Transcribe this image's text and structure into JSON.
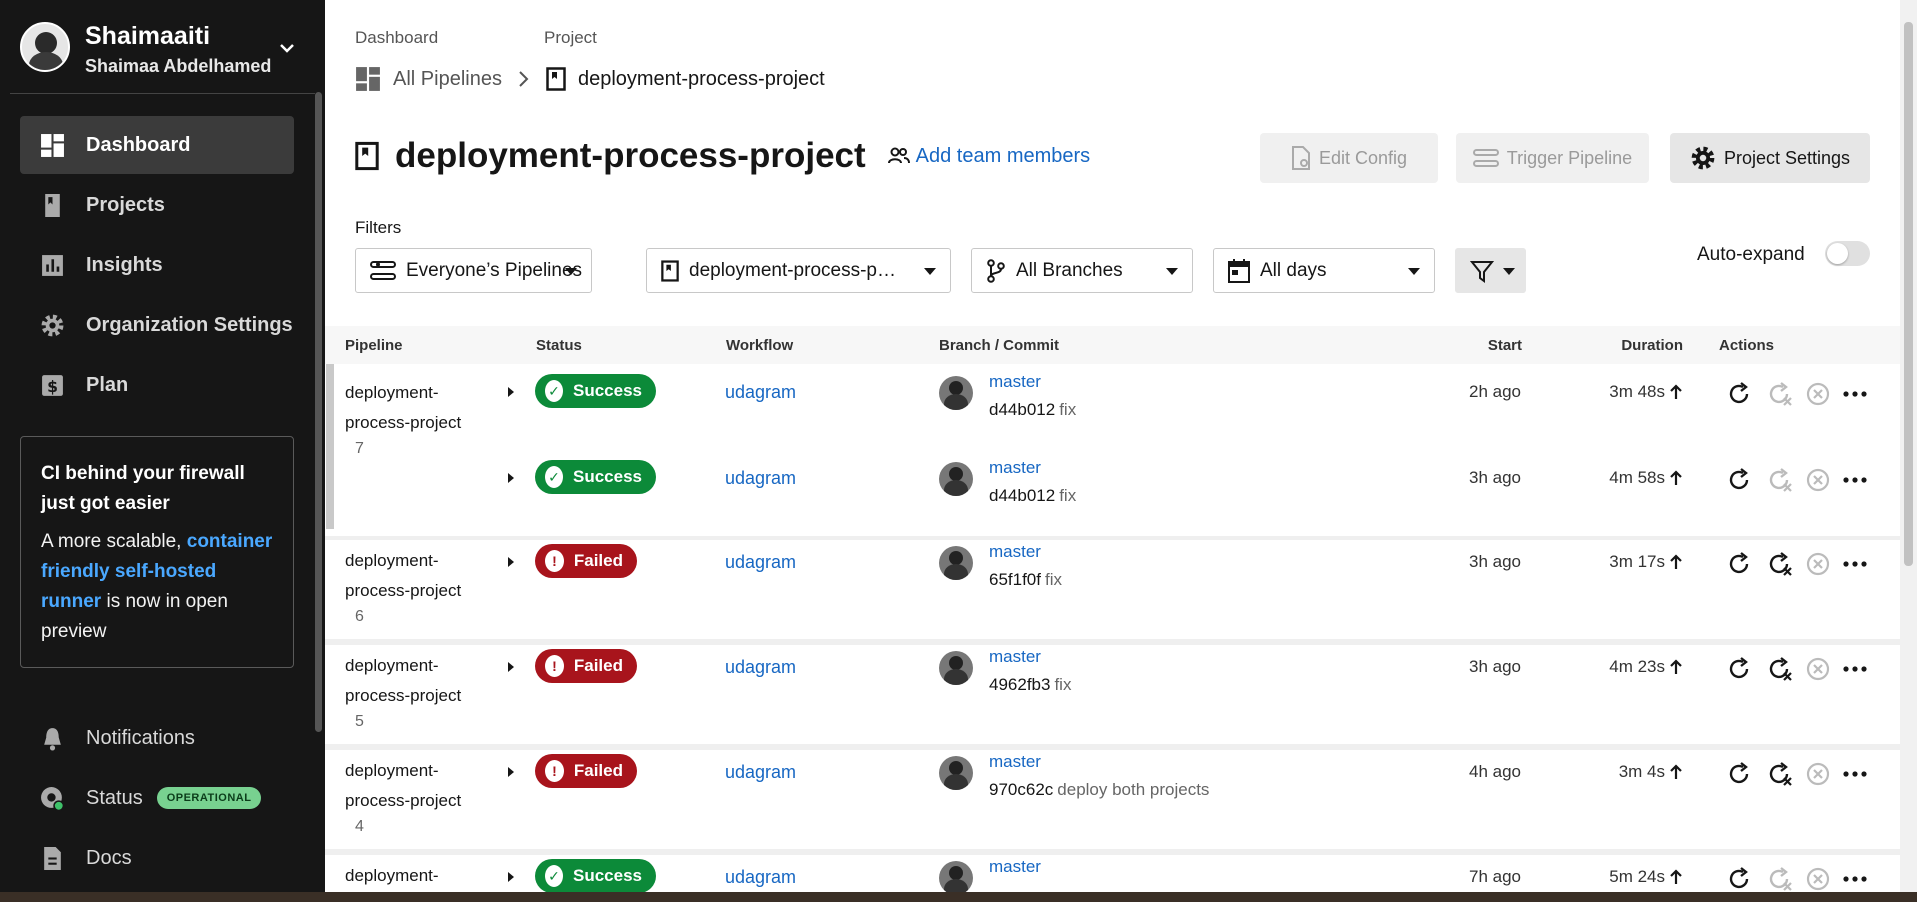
{
  "user": {
    "username": "Shaimaaiti",
    "full_name": "Shaimaa Abdelhamed"
  },
  "nav": {
    "items": [
      {
        "label": "Dashboard",
        "icon": "dashboard-icon",
        "active": true
      },
      {
        "label": "Projects",
        "icon": "projects-icon"
      },
      {
        "label": "Insights",
        "icon": "insights-icon"
      },
      {
        "label": "Organization Settings",
        "icon": "gear-icon"
      },
      {
        "label": "Plan",
        "icon": "dollar-icon"
      }
    ]
  },
  "promo": {
    "title": "CI behind your firewall just got easier",
    "text_before": "A more scalable,",
    "link": "container friendly self-hosted runner",
    "text_after": "is now in open preview"
  },
  "bottom_nav": {
    "notifications": "Notifications",
    "status": "Status",
    "status_badge": "OPERATIONAL",
    "docs": "Docs"
  },
  "breadcrumb": {
    "label_dashboard": "Dashboard",
    "label_project": "Project",
    "all_pipelines": "All Pipelines",
    "project": "deployment-process-project"
  },
  "header": {
    "title": "deployment-process-project",
    "add_team": "Add team members",
    "edit_config": "Edit Config",
    "trigger_pipeline": "Trigger Pipeline",
    "project_settings": "Project Settings"
  },
  "filters": {
    "label": "Filters",
    "pipelines": "Everyone’s Pipelines",
    "project": "deployment-process-p…",
    "branches": "All Branches",
    "days": "All days",
    "auto_expand": "Auto-expand"
  },
  "table": {
    "columns": {
      "pipeline": "Pipeline",
      "status": "Status",
      "workflow": "Workflow",
      "branch_commit": "Branch / Commit",
      "start": "Start",
      "duration": "Duration",
      "actions": "Actions"
    },
    "rows": [
      {
        "pipeline": "deployment-process-project",
        "number": "7",
        "status": "Success",
        "workflow": "udagram",
        "branch": "master",
        "commit": "d44b012",
        "message": "fix",
        "start": "2h ago",
        "duration": "3m 48s"
      },
      {
        "pipeline": "",
        "number": "",
        "status": "Success",
        "workflow": "udagram",
        "branch": "master",
        "commit": "d44b012",
        "message": "fix",
        "start": "3h ago",
        "duration": "4m 58s"
      },
      {
        "pipeline": "deployment-process-project",
        "number": "6",
        "status": "Failed",
        "workflow": "udagram",
        "branch": "master",
        "commit": "65f1f0f",
        "message": "fix",
        "start": "3h ago",
        "duration": "3m 17s"
      },
      {
        "pipeline": "deployment-process-project",
        "number": "5",
        "status": "Failed",
        "workflow": "udagram",
        "branch": "master",
        "commit": "4962fb3",
        "message": "fix",
        "start": "3h ago",
        "duration": "4m 23s"
      },
      {
        "pipeline": "deployment-process-project",
        "number": "4",
        "status": "Failed",
        "workflow": "udagram",
        "branch": "master",
        "commit": "970c62c",
        "message": "deploy both projects",
        "start": "4h ago",
        "duration": "3m 4s"
      },
      {
        "pipeline": "deployment-",
        "number": "",
        "status": "Success",
        "workflow": "udagram",
        "branch": "master",
        "commit": "",
        "message": "",
        "start": "7h ago",
        "duration": "5m 24s"
      }
    ]
  },
  "colors": {
    "success": "#0c8a39",
    "failed": "#a8141c",
    "link": "#1767c3",
    "sidebar": "#161616"
  }
}
